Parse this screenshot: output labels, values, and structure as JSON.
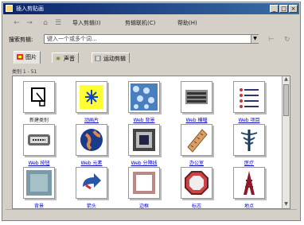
{
  "window": {
    "title": "插入剪贴画"
  },
  "titlebar": {
    "minimize": "_",
    "maximize": "□",
    "close": "×"
  },
  "toolbar": {
    "back": "←",
    "forward": "→",
    "item1": "导入剪辑(I)",
    "item2": "剪辑联机(C)",
    "item3": "帮助(H)"
  },
  "address": {
    "label": "搜索剪辑:",
    "placeholder": "键入一个或多个词...",
    "dropdown": "▼"
  },
  "tabs": [
    "图片",
    "声音",
    "运动剪辑"
  ],
  "count_label": "类别 1 - 51",
  "items": [
    {
      "label": "新建类别",
      "link": false
    },
    {
      "label": "动画片",
      "link": true
    },
    {
      "label": "Web 背景",
      "link": true
    },
    {
      "label": "Web 横幅",
      "link": true
    },
    {
      "label": "Web 项目",
      "link": true
    },
    {
      "label": "Web 按钮",
      "link": true
    },
    {
      "label": "Web 元素",
      "link": true
    },
    {
      "label": "Web 分隔线",
      "link": true
    },
    {
      "label": "办公室",
      "link": true
    },
    {
      "label": "医疗",
      "link": true
    },
    {
      "label": "背景",
      "link": true
    },
    {
      "label": "箭头",
      "link": true
    },
    {
      "label": "边框",
      "link": true
    },
    {
      "label": "标志",
      "link": true
    },
    {
      "label": "地点",
      "link": true
    }
  ],
  "colors": {
    "accent": "#0a246a",
    "link": "#0000cc"
  },
  "icons": [
    "new-category-icon",
    "star-icon",
    "bubbles-icon",
    "banner-icon",
    "list-icon",
    "button-icon",
    "globe-icon",
    "frame-icon",
    "ruler-icon",
    "caduceus-icon",
    "texture-icon",
    "arrow-icon",
    "border-icon",
    "sign-icon",
    "tower-icon"
  ]
}
